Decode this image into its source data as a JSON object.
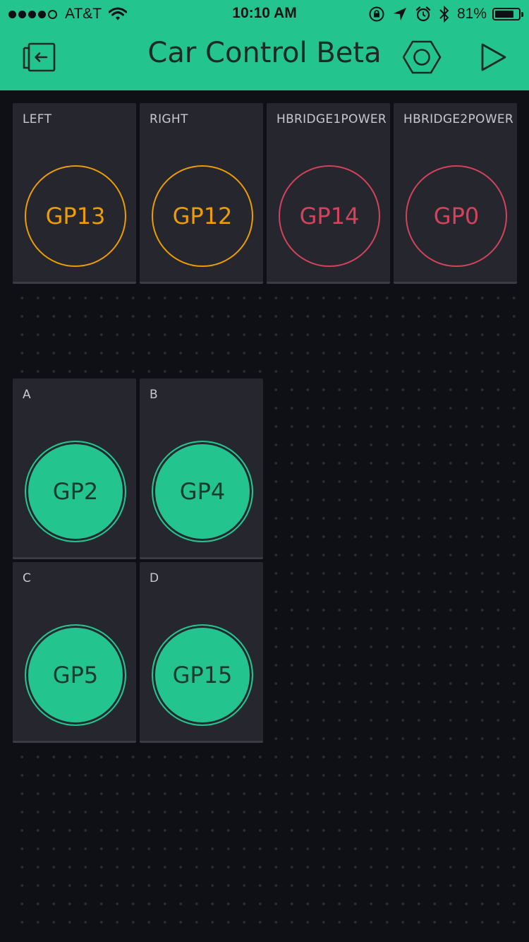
{
  "status_bar": {
    "carrier": "AT&T",
    "time": "10:10 AM",
    "battery": "81%",
    "battery_level": 0.81,
    "signal_bars_filled": 4,
    "signal_bars_total": 5
  },
  "header": {
    "title": "Car Control Beta",
    "back_icon": "exit-project-icon",
    "settings_icon": "hexagon-settings-icon",
    "play_icon": "play-icon"
  },
  "colors": {
    "accent": "#23c48e",
    "orange": "#ed9d00",
    "red": "#d3435c",
    "background": "#0f1015",
    "tile": "#25262e"
  },
  "widgets": [
    {
      "label": "LEFT",
      "pin": "GP13",
      "style": "outline",
      "color": "#ed9d00"
    },
    {
      "label": "RIGHT",
      "pin": "GP12",
      "style": "outline",
      "color": "#ed9d00"
    },
    {
      "label": "HBRIDGE1POWER",
      "pin": "GP14",
      "style": "outline",
      "color": "#d3435c"
    },
    {
      "label": "HBRIDGE2POWER",
      "pin": "GP0",
      "style": "outline",
      "color": "#d3435c"
    },
    {
      "label": "A",
      "pin": "GP2",
      "style": "filled",
      "color": "#23c48e"
    },
    {
      "label": "B",
      "pin": "GP4",
      "style": "filled",
      "color": "#23c48e"
    },
    {
      "label": "C",
      "pin": "GP5",
      "style": "filled",
      "color": "#23c48e"
    },
    {
      "label": "D",
      "pin": "GP15",
      "style": "filled",
      "color": "#23c48e"
    }
  ]
}
